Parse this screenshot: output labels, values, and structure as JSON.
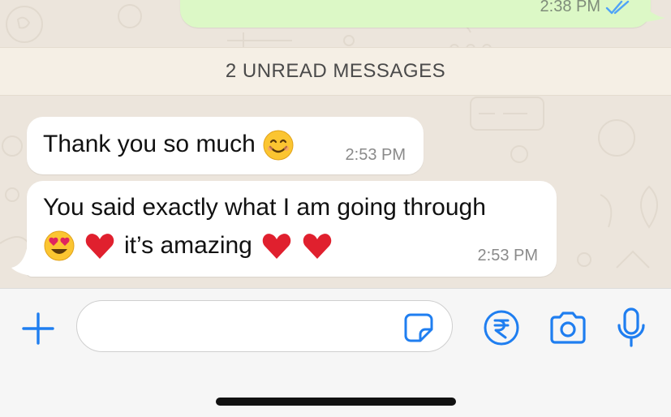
{
  "outgoing": {
    "time": "2:38 PM",
    "status_icon": "double-check-icon"
  },
  "unread_banner": {
    "label": "2 UNREAD MESSAGES"
  },
  "messages": [
    {
      "text": "Thank you so much",
      "emojis": [
        "smiling-face-emoji"
      ],
      "time": "2:53 PM"
    },
    {
      "line1": "You said exactly what I am going through",
      "line2_text": "it’s amazing",
      "emojis_before": [
        "heart-eyes-emoji",
        "red-heart-emoji"
      ],
      "emojis_after": [
        "red-heart-emoji",
        "red-heart-emoji"
      ],
      "time": "2:53 PM"
    }
  ],
  "composer": {
    "value": "",
    "placeholder": "",
    "icons": [
      "plus-icon",
      "sticker-icon",
      "rupee-payment-icon",
      "camera-icon",
      "microphone-icon"
    ]
  },
  "colors": {
    "accent": "#1f7ef0",
    "outgoing_bubble": "#dcf8c6",
    "incoming_bubble": "#ffffff",
    "chat_background": "#ece5dc",
    "banner_background": "#f5efe5"
  }
}
